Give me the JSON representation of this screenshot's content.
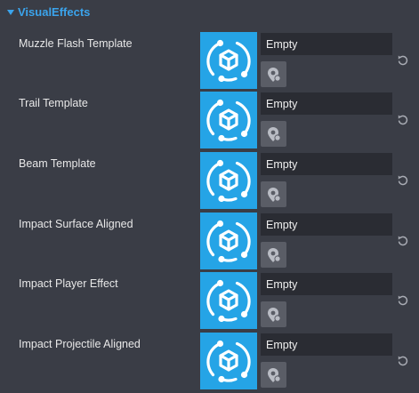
{
  "section": {
    "title": "VisualEffects",
    "toggle_icon": "triangle-down-icon",
    "accent_color": "#3ba4ec"
  },
  "properties": [
    {
      "label": "Muzzle Flash Template",
      "value": "Empty"
    },
    {
      "label": "Trail Template",
      "value": "Empty"
    },
    {
      "label": "Beam Template",
      "value": "Empty"
    },
    {
      "label": "Impact Surface Aligned",
      "value": "Empty"
    },
    {
      "label": "Impact Player Effect",
      "value": "Empty"
    },
    {
      "label": "Impact Projectile Aligned",
      "value": "Empty"
    }
  ],
  "icons": {
    "thumbnail": "template-asset-icon",
    "picker": "asset-picker-icon",
    "reset": "reset-icon"
  },
  "colors": {
    "background": "#3a3d46",
    "thumbnail": "#25a4e6",
    "field": "#2a2c33",
    "picker_button": "#5a5d66"
  }
}
